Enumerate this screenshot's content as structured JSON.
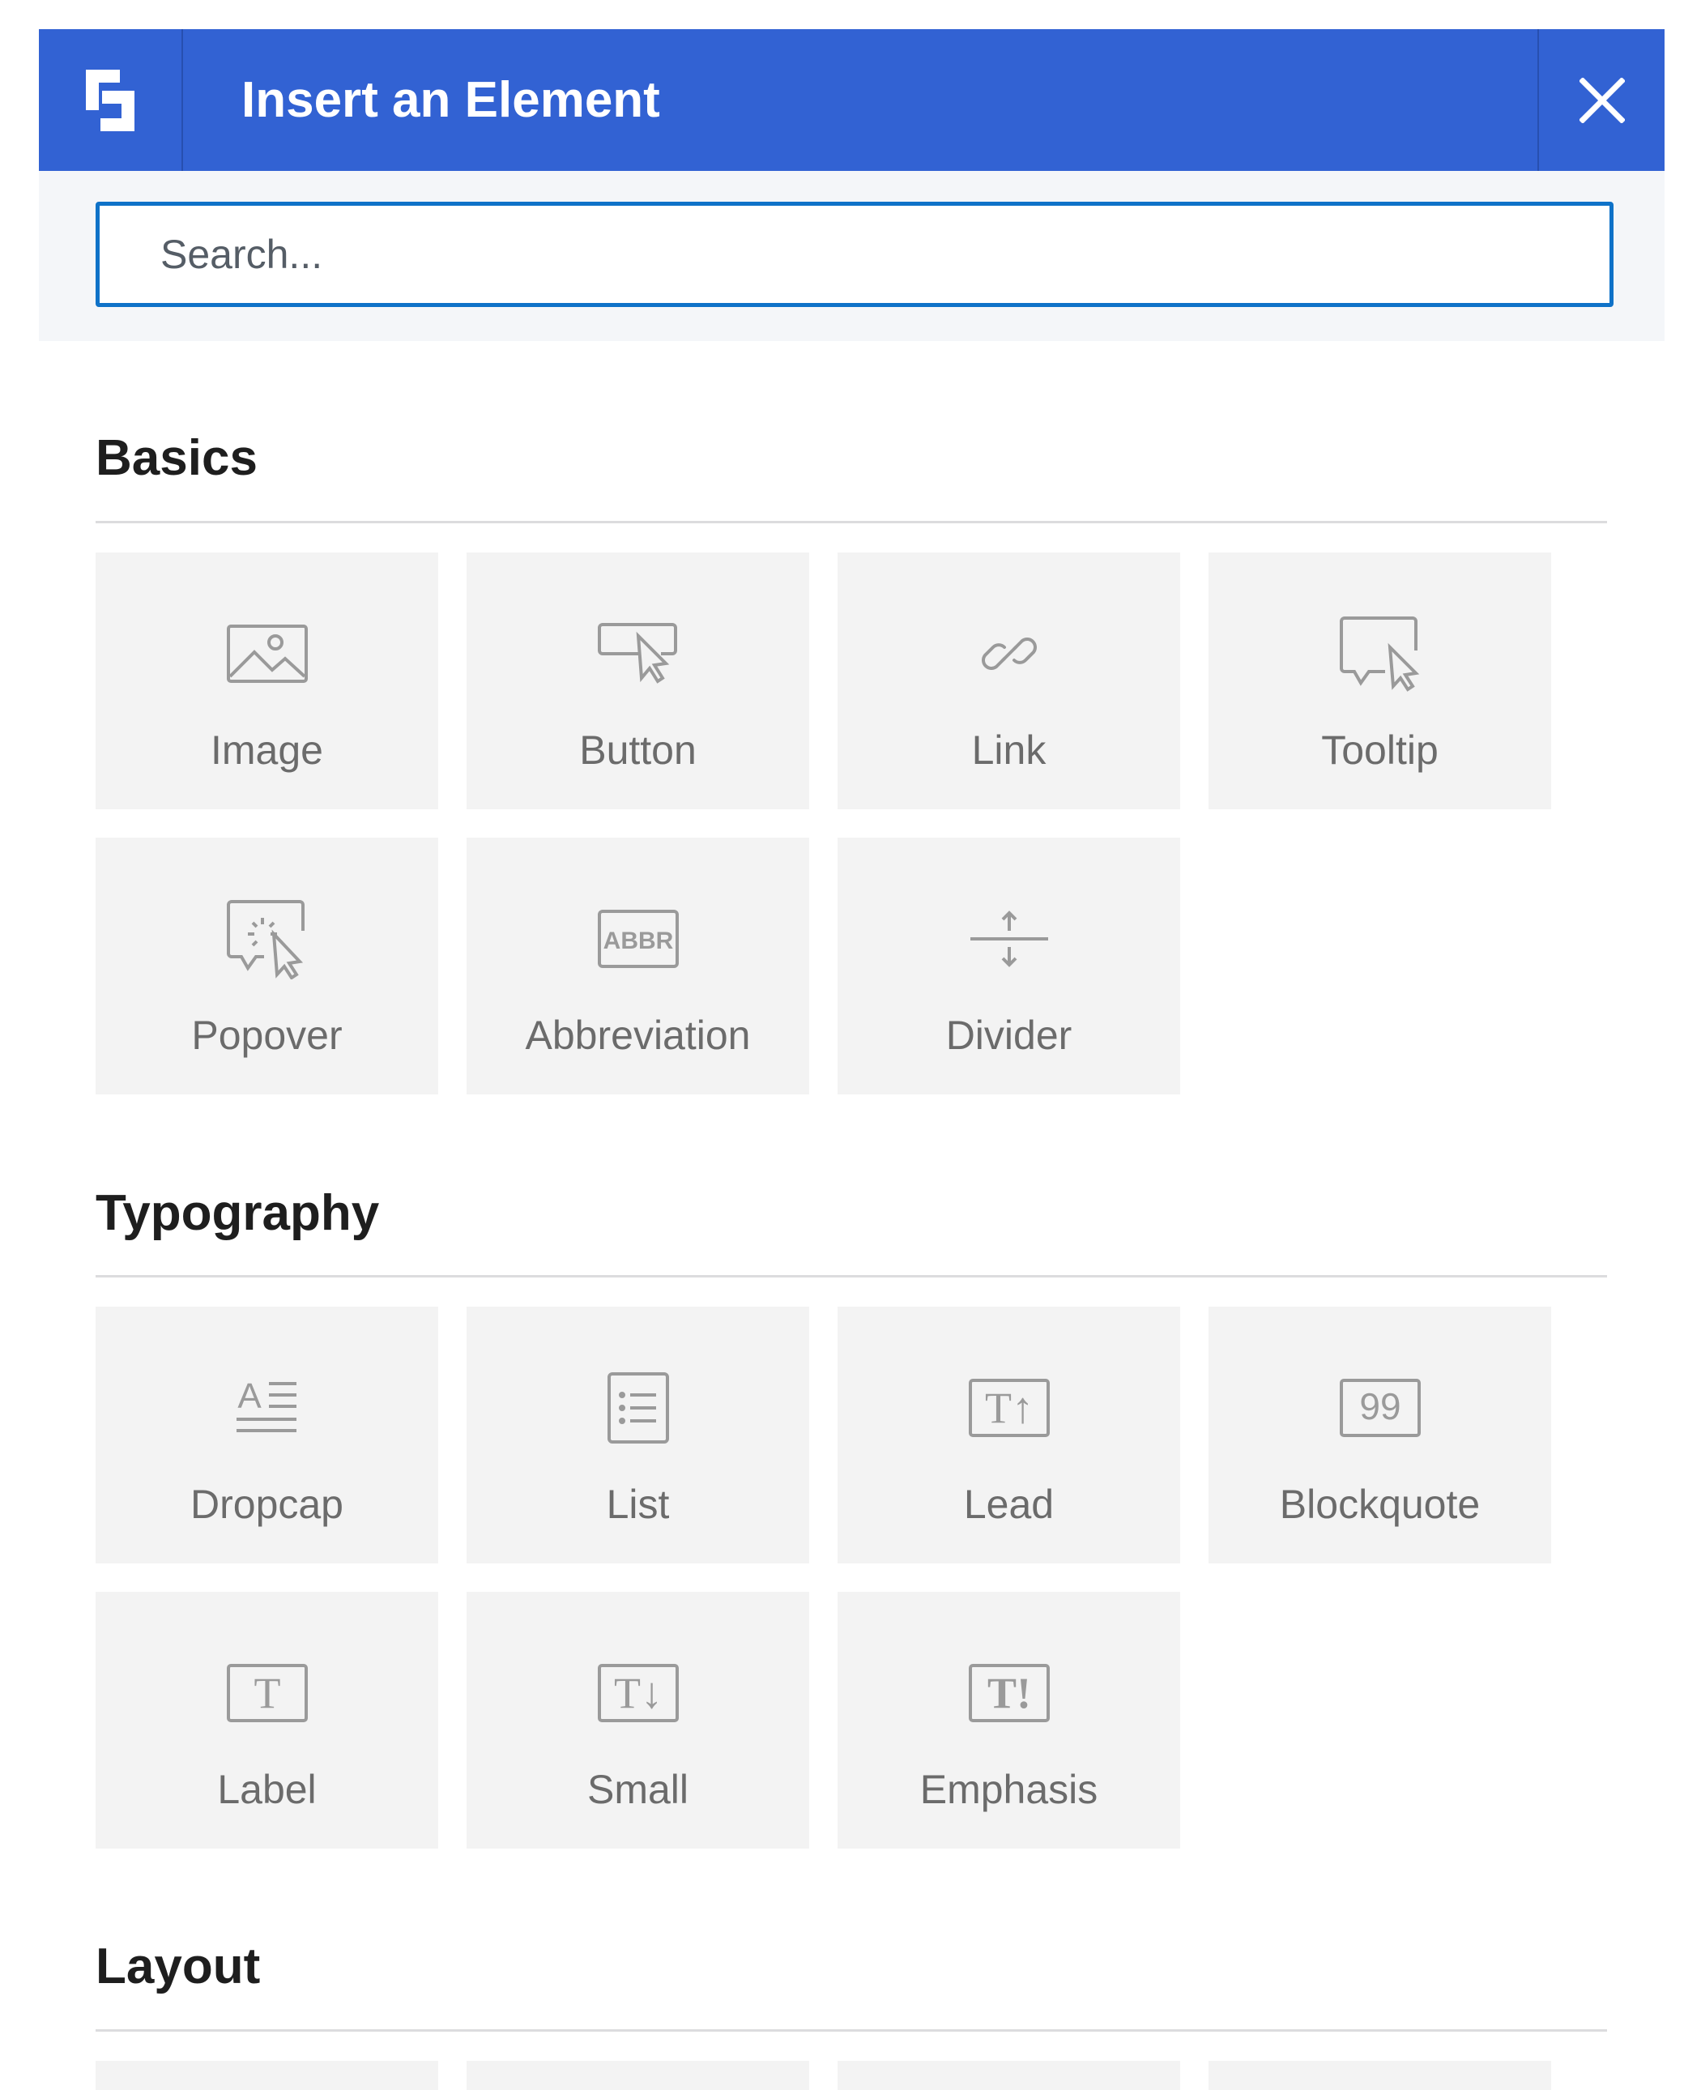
{
  "header": {
    "title": "Insert an Element",
    "logo_icon": "block-logo-icon",
    "close_icon": "close-icon",
    "background": "#3262d3"
  },
  "search": {
    "placeholder": "Search..."
  },
  "sections": [
    {
      "title": "Basics",
      "items": [
        {
          "label": "Image",
          "icon": "image-icon"
        },
        {
          "label": "Button",
          "icon": "button-cursor-icon"
        },
        {
          "label": "Link",
          "icon": "link-icon"
        },
        {
          "label": "Tooltip",
          "icon": "tooltip-icon"
        },
        {
          "label": "Popover",
          "icon": "popover-icon"
        },
        {
          "label": "Abbreviation",
          "icon": "abbr-icon",
          "icon_text": "ABBR"
        },
        {
          "label": "Divider",
          "icon": "divider-icon"
        }
      ]
    },
    {
      "title": "Typography",
      "items": [
        {
          "label": "Dropcap",
          "icon": "dropcap-icon",
          "icon_text": "A"
        },
        {
          "label": "List",
          "icon": "list-icon"
        },
        {
          "label": "Lead",
          "icon": "lead-icon",
          "icon_text": "T↑"
        },
        {
          "label": "Blockquote",
          "icon": "blockquote-icon",
          "icon_text": "99"
        },
        {
          "label": "Label",
          "icon": "label-icon",
          "icon_text": "T"
        },
        {
          "label": "Small",
          "icon": "small-icon",
          "icon_text": "T↓"
        },
        {
          "label": "Emphasis",
          "icon": "emphasis-icon",
          "icon_text": "T!"
        }
      ]
    },
    {
      "title": "Layout",
      "items": []
    }
  ]
}
